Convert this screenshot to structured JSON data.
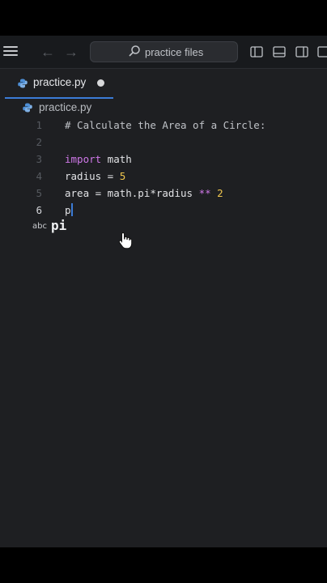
{
  "search": {
    "label": "practice files"
  },
  "tab": {
    "name": "practice.py",
    "modified": true
  },
  "breadcrumb": {
    "file": "practice.py"
  },
  "editor": {
    "lines": [
      {
        "number": "1",
        "text": "# Calculate the Area of a Circle:"
      },
      {
        "number": "2",
        "text": ""
      },
      {
        "number": "3",
        "keyword": "import",
        "rest": " math"
      },
      {
        "number": "4",
        "prefix": "radius = ",
        "value": "5"
      },
      {
        "number": "5",
        "prefix": "area = math.pi*radius ",
        "op": "**",
        "value": "2"
      },
      {
        "number": "6",
        "text": "p"
      }
    ]
  },
  "suggestion": {
    "kind": "abc",
    "text": "pi"
  },
  "colors": {
    "accent": "#3b7bd6",
    "keyword": "#cf78e8",
    "number": "#f0c74e"
  }
}
